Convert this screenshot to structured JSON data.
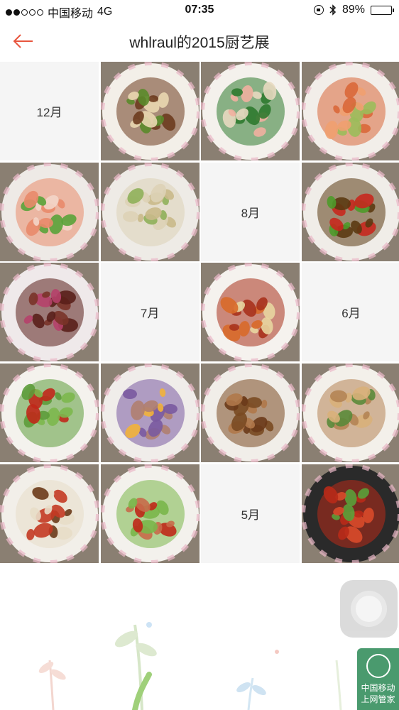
{
  "status_bar": {
    "carrier": "中国移动",
    "network": "4G",
    "time": "07:35",
    "battery": "89%",
    "battery_level": 0.89,
    "signal_bars_filled": 2,
    "signal_bars_total": 5
  },
  "nav": {
    "back_icon": "arrow-left-icon",
    "title": "whlraul的2015厨艺展",
    "accent": "#e8553e"
  },
  "grid": {
    "cells": [
      {
        "kind": "month",
        "label": "12月"
      },
      {
        "kind": "photo",
        "name": "photo-enoki-mushroom-soy"
      },
      {
        "kind": "photo",
        "name": "photo-shrimp-broccoli"
      },
      {
        "kind": "photo",
        "name": "photo-stirfried-shrimp"
      },
      {
        "kind": "photo",
        "name": "photo-boiled-prawns"
      },
      {
        "kind": "photo",
        "name": "photo-pearl-meatballs"
      },
      {
        "kind": "month",
        "label": "8月"
      },
      {
        "kind": "photo",
        "name": "photo-braised-peppers"
      },
      {
        "kind": "photo",
        "name": "photo-braised-gizzards"
      },
      {
        "kind": "month",
        "label": "7月"
      },
      {
        "kind": "photo",
        "name": "photo-sesame-pork"
      },
      {
        "kind": "month",
        "label": "6月"
      },
      {
        "kind": "photo",
        "name": "photo-edamame-chili"
      },
      {
        "kind": "photo",
        "name": "photo-eggplant-mince"
      },
      {
        "kind": "photo",
        "name": "photo-shredded-pork"
      },
      {
        "kind": "photo",
        "name": "photo-stirfried-mushrooms"
      },
      {
        "kind": "photo",
        "name": "photo-chili-chicken"
      },
      {
        "kind": "photo",
        "name": "photo-peas-minced-pork"
      },
      {
        "kind": "month",
        "label": "5月"
      },
      {
        "kind": "photo",
        "name": "photo-crayfish"
      }
    ]
  },
  "floating": {
    "assistive_icon": "assistive-touch-icon"
  },
  "badge": {
    "line1": "中国移动",
    "line2": "上网管家",
    "color": "#4a9a6e"
  }
}
